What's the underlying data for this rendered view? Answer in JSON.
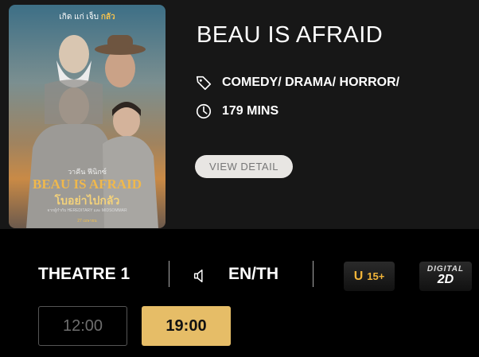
{
  "movie": {
    "title": "BEAU IS AFRAID",
    "genre": "COMEDY/ DRAMA/ HORROR/",
    "duration": "179 MINS",
    "view_detail_label": "VIEW DETAIL",
    "poster": {
      "tagline_prefix": "เกิด แก่ เจ็บ ",
      "tagline_accent": "กลัว",
      "cast_name": "วาคีน ฟีนิกซ์",
      "title": "BEAU IS AFRAID",
      "thai_title": "โบอย่าไปกลัว",
      "credits": "จากผู้กำกับ HEREDITARY และ MIDSOMMAR",
      "release": "27 เมษายน"
    }
  },
  "showing": {
    "theatre": "THEATRE 1",
    "language": "EN/TH",
    "rating_letter": "U",
    "rating_age": "15+",
    "format_top": "DIGITAL",
    "format_bottom": "2D"
  },
  "showtimes": [
    {
      "time": "12:00",
      "state": "past"
    },
    {
      "time": "19:00",
      "state": "available"
    }
  ],
  "icons": {
    "genre": "tag-icon",
    "duration": "clock-icon",
    "language": "speaker-icon"
  },
  "colors": {
    "accent_gold": "#e6bd67",
    "background": "#000000",
    "panel": "#171717"
  }
}
